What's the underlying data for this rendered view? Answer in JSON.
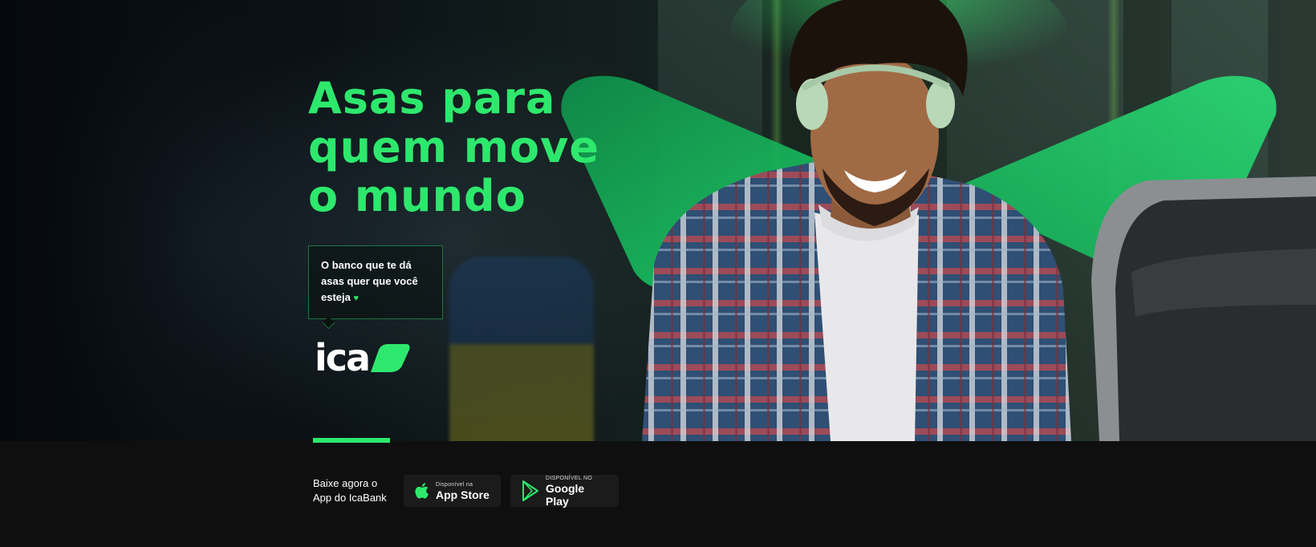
{
  "hero": {
    "headline": "Asas para\nquem move\no mundo",
    "tagline": "O banco que te dá asas quer que você esteja",
    "tagline_heart": "♥",
    "logo_text": "ica",
    "accent_color": "#2ee86d"
  },
  "footer": {
    "download_text": "Baixe agora o\nApp do IcaBank",
    "app_store": {
      "small": "Disponível na",
      "big": "App Store",
      "icon": "apple-icon"
    },
    "google_play": {
      "small": "DISPONÍVEL NO",
      "big": "Google Play",
      "icon": "google-play-icon"
    }
  }
}
